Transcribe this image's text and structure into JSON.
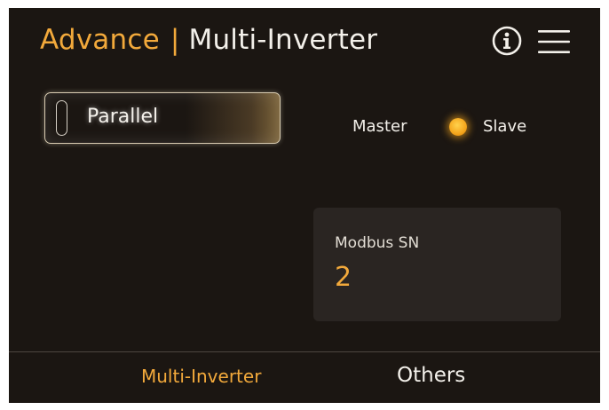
{
  "header": {
    "section": "Advance",
    "separator": "|",
    "page": "Multi-Inverter",
    "info_icon": "info-icon",
    "menu_icon": "hamburger-menu-icon"
  },
  "mode": {
    "label": "Parallel"
  },
  "role": {
    "options": [
      "Master",
      "Slave"
    ],
    "selected": "Slave"
  },
  "modbus": {
    "label": "Modbus SN",
    "value": "2"
  },
  "tabs": [
    {
      "label": "Multi-Inverter",
      "active": true
    },
    {
      "label": "Others",
      "active": false
    }
  ],
  "colors": {
    "accent": "#f2a93b",
    "background": "#1b1612",
    "card": "#2a2522",
    "text": "#f3f0ea"
  }
}
